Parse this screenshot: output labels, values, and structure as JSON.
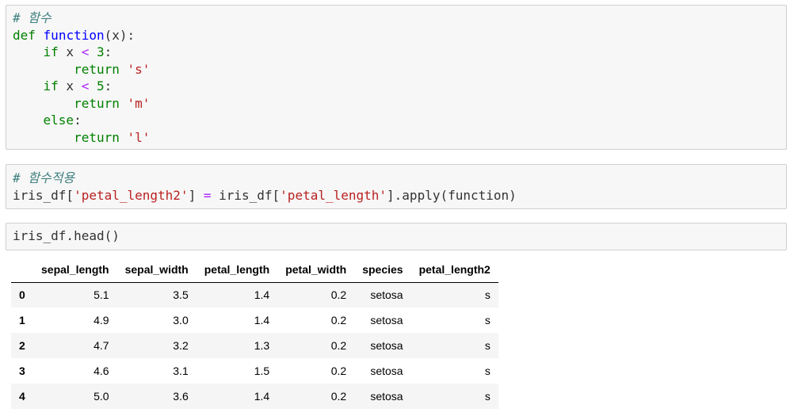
{
  "cells": [
    {
      "lines": [
        [
          {
            "t": "# 함수",
            "c": "cm"
          }
        ],
        [
          {
            "t": "def",
            "c": "kw"
          },
          {
            "t": " ",
            "c": "plain"
          },
          {
            "t": "function",
            "c": "fn"
          },
          {
            "t": "(x):",
            "c": "plain"
          }
        ],
        [
          {
            "t": "    ",
            "c": "plain"
          },
          {
            "t": "if",
            "c": "kw"
          },
          {
            "t": " x ",
            "c": "plain"
          },
          {
            "t": "<",
            "c": "op"
          },
          {
            "t": " ",
            "c": "plain"
          },
          {
            "t": "3",
            "c": "num"
          },
          {
            "t": ":",
            "c": "plain"
          }
        ],
        [
          {
            "t": "        ",
            "c": "plain"
          },
          {
            "t": "return",
            "c": "kw"
          },
          {
            "t": " ",
            "c": "plain"
          },
          {
            "t": "'s'",
            "c": "str"
          }
        ],
        [
          {
            "t": "    ",
            "c": "plain"
          },
          {
            "t": "if",
            "c": "kw"
          },
          {
            "t": " x ",
            "c": "plain"
          },
          {
            "t": "<",
            "c": "op"
          },
          {
            "t": " ",
            "c": "plain"
          },
          {
            "t": "5",
            "c": "num"
          },
          {
            "t": ":",
            "c": "plain"
          }
        ],
        [
          {
            "t": "        ",
            "c": "plain"
          },
          {
            "t": "return",
            "c": "kw"
          },
          {
            "t": " ",
            "c": "plain"
          },
          {
            "t": "'m'",
            "c": "str"
          }
        ],
        [
          {
            "t": "    ",
            "c": "plain"
          },
          {
            "t": "else",
            "c": "kw"
          },
          {
            "t": ":",
            "c": "plain"
          }
        ],
        [
          {
            "t": "        ",
            "c": "plain"
          },
          {
            "t": "return",
            "c": "kw"
          },
          {
            "t": " ",
            "c": "plain"
          },
          {
            "t": "'l'",
            "c": "str"
          }
        ]
      ]
    },
    {
      "lines": [
        [
          {
            "t": "# 함수적용",
            "c": "cm"
          }
        ],
        [
          {
            "t": "iris_df[",
            "c": "plain"
          },
          {
            "t": "'petal_length2'",
            "c": "str"
          },
          {
            "t": "] ",
            "c": "plain"
          },
          {
            "t": "=",
            "c": "op"
          },
          {
            "t": " iris_df[",
            "c": "plain"
          },
          {
            "t": "'petal_length'",
            "c": "str"
          },
          {
            "t": "].apply(function)",
            "c": "plain"
          }
        ]
      ]
    },
    {
      "lines": [
        [
          {
            "t": "iris_df.head()",
            "c": "plain"
          }
        ]
      ]
    }
  ],
  "table": {
    "columns": [
      "sepal_length",
      "sepal_width",
      "petal_length",
      "petal_width",
      "species",
      "petal_length2"
    ],
    "rows": [
      {
        "index": "0",
        "cells": [
          "5.1",
          "3.5",
          "1.4",
          "0.2",
          "setosa",
          "s"
        ]
      },
      {
        "index": "1",
        "cells": [
          "4.9",
          "3.0",
          "1.4",
          "0.2",
          "setosa",
          "s"
        ]
      },
      {
        "index": "2",
        "cells": [
          "4.7",
          "3.2",
          "1.3",
          "0.2",
          "setosa",
          "s"
        ]
      },
      {
        "index": "3",
        "cells": [
          "4.6",
          "3.1",
          "1.5",
          "0.2",
          "setosa",
          "s"
        ]
      },
      {
        "index": "4",
        "cells": [
          "5.0",
          "3.6",
          "1.4",
          "0.2",
          "setosa",
          "s"
        ]
      }
    ]
  }
}
